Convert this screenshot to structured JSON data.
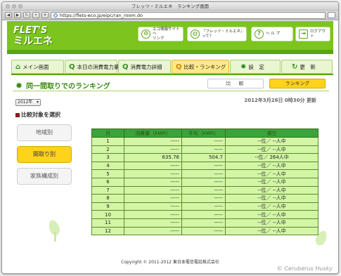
{
  "window": {
    "title": "フレッツ・ミルエネ　ランキング画面"
  },
  "browser": {
    "url": "https://flets-eco.jp/eipc/ran_room.do"
  },
  "header": {
    "logo_line1": "FLET'S",
    "logo_line2": "ミルエネ",
    "eco_link_line1": "エコ情報サイトへ",
    "eco_link_line2": "リンク",
    "about_link": "『フレッツ・ミルエネ』って？",
    "help": "ヘ ル プ",
    "logout": "ログアウト"
  },
  "nav": {
    "tabs": [
      {
        "label": "メイン画面",
        "icon": "home-icon",
        "active": false
      },
      {
        "label": "本日の消費電力量",
        "icon": "magnifier-icon",
        "active": false
      },
      {
        "label": "消費電力詳細",
        "icon": "magnifier-icon",
        "active": false
      },
      {
        "label": "比較・ランキング",
        "icon": "magnifier-icon",
        "active": true
      },
      {
        "label": "設　定",
        "icon": "gear-icon",
        "active": false
      },
      {
        "label": "更　新",
        "icon": "refresh-icon",
        "active": false
      }
    ]
  },
  "section": {
    "title": "同一間取りでのランキング",
    "toggle_compare": "比　較",
    "toggle_ranking": "ランキング",
    "year_value": "2012年",
    "updated": "2012年3月26日 0時30分 更新",
    "choose_label": "比較対象を選択",
    "side_buttons": [
      "地域別",
      "間取り別",
      "家族構成別"
    ]
  },
  "table": {
    "headers": [
      "月",
      "消費量（kWh）",
      "平均（kWh）",
      "順位"
    ],
    "rows": [
      [
        "1",
        "-----",
        "-----",
        "--位／ --人中"
      ],
      [
        "2",
        "-----",
        "-----",
        "--位／ --人中"
      ],
      [
        "3",
        "635.76",
        "504.7",
        "--位／ 264人中"
      ],
      [
        "4",
        "-----",
        "-----",
        "--位／ --人中"
      ],
      [
        "5",
        "-----",
        "-----",
        "--位／ --人中"
      ],
      [
        "6",
        "-----",
        "-----",
        "--位／ --人中"
      ],
      [
        "7",
        "-----",
        "-----",
        "--位／ --人中"
      ],
      [
        "8",
        "-----",
        "-----",
        "--位／ --人中"
      ],
      [
        "9",
        "-----",
        "-----",
        "--位／ --人中"
      ],
      [
        "10",
        "-----",
        "-----",
        "--位／ --人中"
      ],
      [
        "11",
        "-----",
        "-----",
        "--位／ --人中"
      ],
      [
        "12",
        "-----",
        "-----",
        "--位／ --人中"
      ]
    ]
  },
  "footer": {
    "copyright": "Copyright © 2011-2012 東日本電信電話株式会社",
    "watermark": "© Ceruberus Husky"
  },
  "colors": {
    "brand_green": "#7cc41e",
    "active_yellow": "#ffd21c",
    "table_row": "#d3f5a6"
  }
}
